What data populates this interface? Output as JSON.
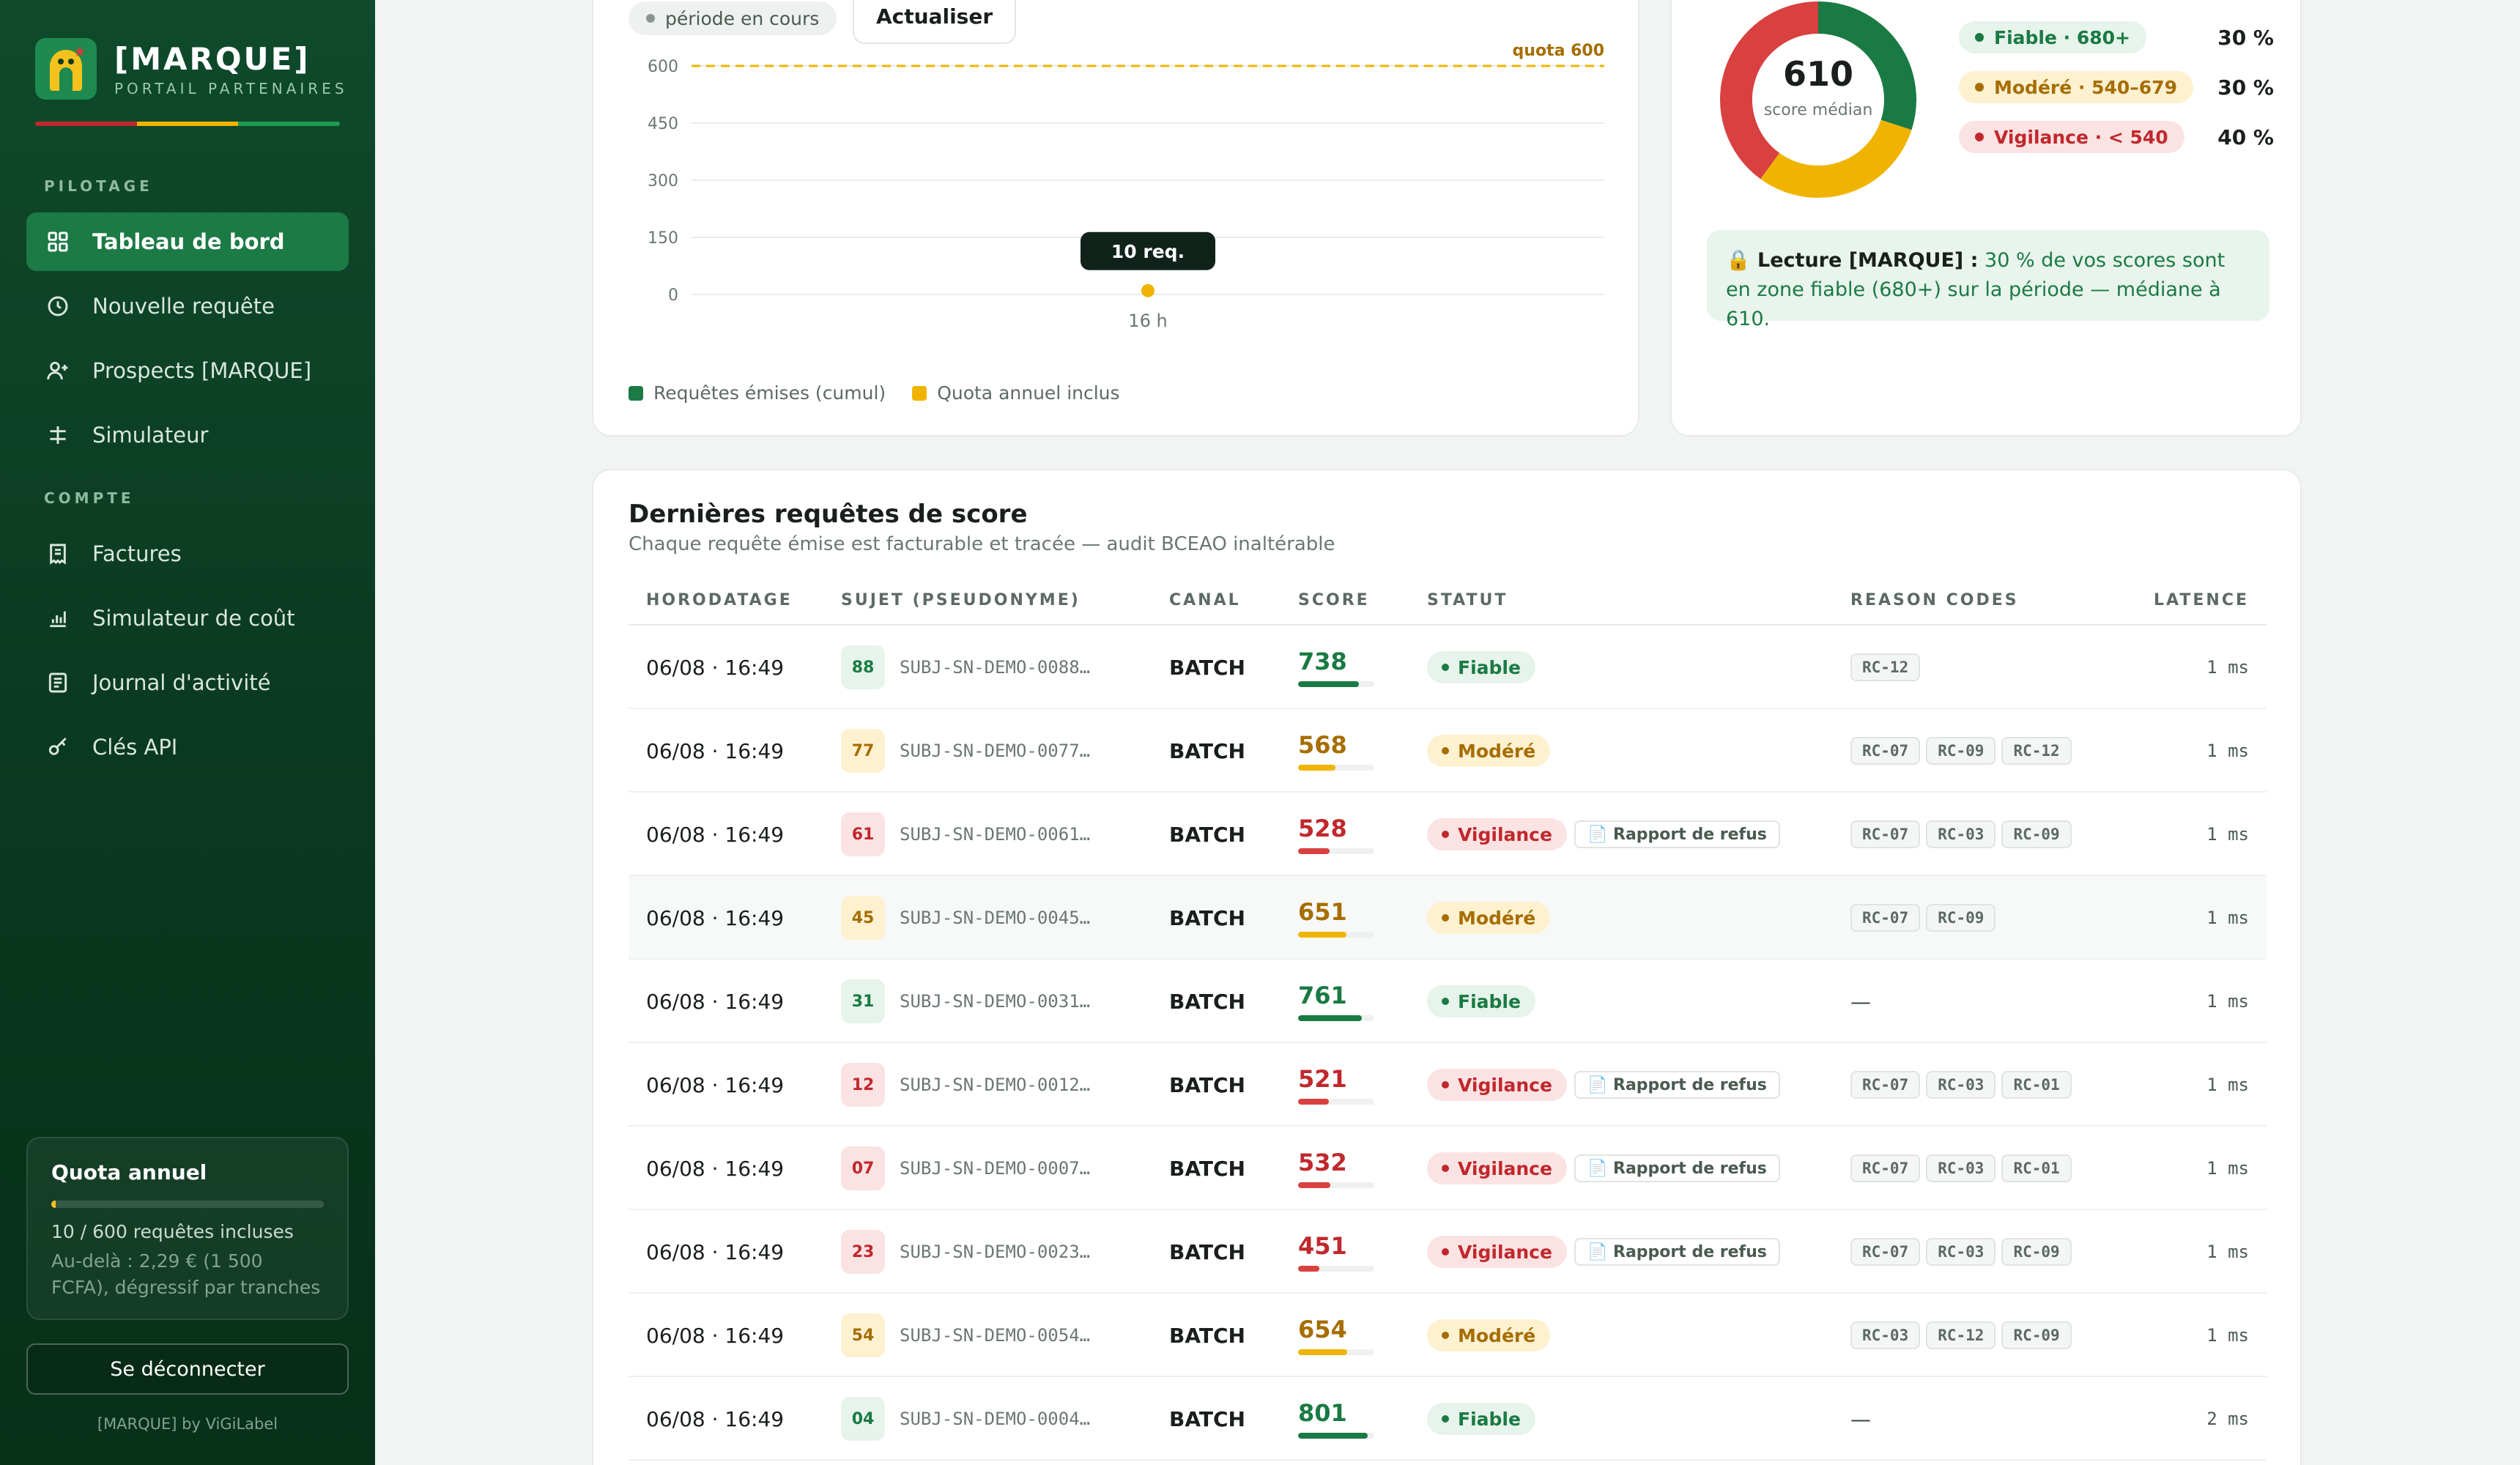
{
  "sidebar": {
    "brand_name": "[MARQUE]",
    "brand_sub": "PORTAIL PARTENAIRES",
    "section_pilotage": "PILOTAGE",
    "section_compte": "COMPTE",
    "nav": {
      "dashboard": "Tableau de bord",
      "new_request": "Nouvelle requête",
      "prospects": "Prospects [MARQUE]",
      "simulator": "Simulateur",
      "invoices": "Factures",
      "cost_simulator": "Simulateur de coût",
      "activity_log": "Journal d'activité",
      "api_keys": "Clés API"
    },
    "quota": {
      "title": "Quota annuel",
      "used_text": "10 / 600 requêtes incluses",
      "used_fraction": 0.0167,
      "note": "Au-delà : 2,29 € (1 500 FCFA), dégressif par tranches"
    },
    "logout": "Se déconnecter",
    "credit": "[MARQUE] by ViGiLabel"
  },
  "chart": {
    "period_pill": "période en cours",
    "refresh_button": "Actualiser",
    "quota_label": "quota 600",
    "tooltip": "10 req.",
    "legend_requests": "Requêtes émises (cumul)",
    "legend_quota": "Quota annuel inclus"
  },
  "chart_data": {
    "type": "line",
    "x": [
      "16 h"
    ],
    "series": [
      {
        "name": "Requêtes émises (cumul)",
        "values": [
          10
        ]
      },
      {
        "name": "Quota annuel inclus",
        "values": [
          600
        ]
      }
    ],
    "yticks": [
      0,
      150,
      300,
      450,
      600
    ],
    "ylim": [
      0,
      600
    ],
    "grid": true,
    "legend_position": "bottom-left"
  },
  "score": {
    "median_value": "610",
    "median_label": "score médian",
    "tiers": [
      {
        "label": "Fiable · 680+",
        "pct": "30 %",
        "share": 30
      },
      {
        "label": "Modéré · 540–679",
        "pct": "30 %",
        "share": 30
      },
      {
        "label": "Vigilance · < 540",
        "pct": "40 %",
        "share": 40
      }
    ],
    "insight_prefix": "🔒 Lecture [MARQUE] :",
    "insight_text": " 30 % de vos scores sont en zone fiable (680+) sur la période — médiane à 610."
  },
  "table": {
    "title": "Dernières requêtes de score",
    "subtitle": "Chaque requête émise est facturable et tracée — audit BCEAO inaltérable",
    "headers": {
      "time": "HORODATAGE",
      "subject": "SUJET (PSEUDONYME)",
      "channel": "CANAL",
      "score": "SCORE",
      "status": "STATUT",
      "codes": "REASON CODES",
      "latency": "LATENCE"
    },
    "refus_label": "📄 Rapport de refus",
    "rows": [
      {
        "time": "06/08 · 16:49",
        "avatar": "88",
        "subject": "SUBJ-SN-DEMO-0088…",
        "channel": "BATCH",
        "score": "738",
        "status": "Fiable",
        "codes": [
          "RC-12"
        ],
        "latency": "1 ms"
      },
      {
        "time": "06/08 · 16:49",
        "avatar": "77",
        "subject": "SUBJ-SN-DEMO-0077…",
        "channel": "BATCH",
        "score": "568",
        "status": "Modéré",
        "codes": [
          "RC-07",
          "RC-09",
          "RC-12"
        ],
        "latency": "1 ms"
      },
      {
        "time": "06/08 · 16:49",
        "avatar": "61",
        "subject": "SUBJ-SN-DEMO-0061…",
        "channel": "BATCH",
        "score": "528",
        "status": "Vigilance",
        "codes": [
          "RC-07",
          "RC-03",
          "RC-09"
        ],
        "latency": "1 ms"
      },
      {
        "time": "06/08 · 16:49",
        "avatar": "45",
        "subject": "SUBJ-SN-DEMO-0045…",
        "channel": "BATCH",
        "score": "651",
        "status": "Modéré",
        "codes": [
          "RC-07",
          "RC-09"
        ],
        "latency": "1 ms"
      },
      {
        "time": "06/08 · 16:49",
        "avatar": "31",
        "subject": "SUBJ-SN-DEMO-0031…",
        "channel": "BATCH",
        "score": "761",
        "status": "Fiable",
        "codes": [],
        "latency": "1 ms"
      },
      {
        "time": "06/08 · 16:49",
        "avatar": "12",
        "subject": "SUBJ-SN-DEMO-0012…",
        "channel": "BATCH",
        "score": "521",
        "status": "Vigilance",
        "codes": [
          "RC-07",
          "RC-03",
          "RC-01"
        ],
        "latency": "1 ms"
      },
      {
        "time": "06/08 · 16:49",
        "avatar": "07",
        "subject": "SUBJ-SN-DEMO-0007…",
        "channel": "BATCH",
        "score": "532",
        "status": "Vigilance",
        "codes": [
          "RC-07",
          "RC-03",
          "RC-01"
        ],
        "latency": "1 ms"
      },
      {
        "time": "06/08 · 16:49",
        "avatar": "23",
        "subject": "SUBJ-SN-DEMO-0023…",
        "channel": "BATCH",
        "score": "451",
        "status": "Vigilance",
        "codes": [
          "RC-07",
          "RC-03",
          "RC-09"
        ],
        "latency": "1 ms"
      },
      {
        "time": "06/08 · 16:49",
        "avatar": "54",
        "subject": "SUBJ-SN-DEMO-0054…",
        "channel": "BATCH",
        "score": "654",
        "status": "Modéré",
        "codes": [
          "RC-03",
          "RC-12",
          "RC-09"
        ],
        "latency": "1 ms"
      },
      {
        "time": "06/08 · 16:49",
        "avatar": "04",
        "subject": "SUBJ-SN-DEMO-0004…",
        "channel": "BATCH",
        "score": "801",
        "status": "Fiable",
        "codes": [],
        "latency": "2 ms"
      }
    ],
    "empty_codes": "—"
  },
  "colors": {
    "brand_green": "#1c7a45",
    "fiable": "#1a7a43",
    "fiable_bg": "#e6f4eb",
    "modere": "#a66d00",
    "modere_bg": "#fdf1d0",
    "modere_bar": "#f0b400",
    "vigilance": "#c0282d",
    "vigilance_bg": "#fbe3e3",
    "vigilance_bar": "#d94040",
    "flag_red": "#c0282d",
    "flag_yellow": "#f0b400",
    "flag_green": "#1e9a52"
  }
}
